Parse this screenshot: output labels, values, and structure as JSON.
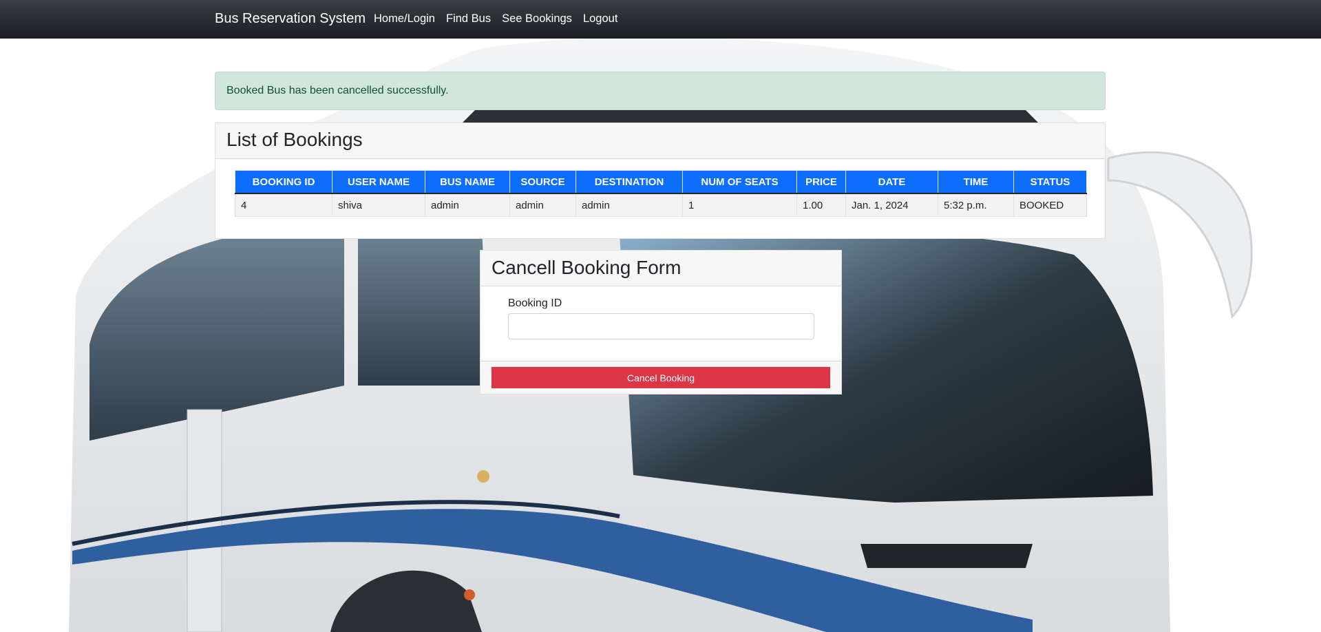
{
  "navbar": {
    "brand": "Bus Reservation System",
    "links": [
      {
        "label": "Home/Login"
      },
      {
        "label": "Find Bus"
      },
      {
        "label": "See Bookings"
      },
      {
        "label": "Logout"
      }
    ]
  },
  "alert": {
    "message": "Booked Bus has been cancelled successfully."
  },
  "bookings": {
    "title": "List of Bookings",
    "columns": [
      "BOOKING ID",
      "USER NAME",
      "BUS NAME",
      "SOURCE",
      "DESTINATION",
      "NUM OF SEATS",
      "PRICE",
      "DATE",
      "TIME",
      "STATUS"
    ],
    "rows": [
      [
        "4",
        "shiva",
        "admin",
        "admin",
        "admin",
        "1",
        "1.00",
        "Jan. 1, 2024",
        "5:32 p.m.",
        "BOOKED"
      ]
    ]
  },
  "cancel_form": {
    "title": "Cancell Booking Form",
    "field_label": "Booking ID",
    "field_value": "",
    "button_label": "Cancel Booking"
  },
  "colors": {
    "navbar": "#272b30",
    "table_header": "#0d6efd",
    "alert_bg": "#d1e7dd",
    "danger": "#dc3545"
  },
  "background": {
    "image": "white-coach-bus-photo"
  }
}
